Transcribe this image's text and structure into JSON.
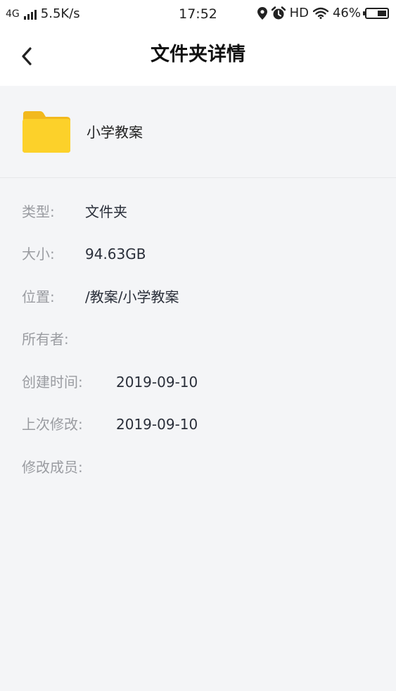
{
  "status_bar": {
    "network_type": "4G",
    "speed": "5.5K/s",
    "time": "17:52",
    "hd_label": "HD",
    "battery_percent": "46%",
    "battery_level": 0.46
  },
  "nav": {
    "title": "文件夹详情",
    "back_icon": "chevron-left-icon"
  },
  "folder": {
    "name": "小学教案",
    "icon": "folder-icon",
    "icon_color": "#fcd12a"
  },
  "details": {
    "type": {
      "label": "类型:",
      "value": "文件夹"
    },
    "size": {
      "label": "大小:",
      "value": "94.63GB"
    },
    "location": {
      "label": "位置:",
      "value": "/教案/小学教案"
    },
    "owner": {
      "label": "所有者:",
      "value": ""
    },
    "created": {
      "label": "创建时间:",
      "value": "2019-09-10"
    },
    "modified": {
      "label": "上次修改:",
      "value": "2019-09-10"
    },
    "modified_by": {
      "label": "修改成员:",
      "value": ""
    }
  }
}
